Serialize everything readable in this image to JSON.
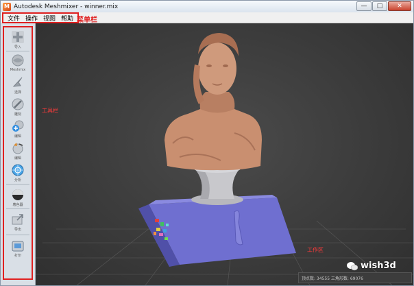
{
  "window": {
    "title": "Autodesk Meshmixer - winner.mix",
    "controls": {
      "minimize": "—",
      "maximize": "□",
      "close": "✕"
    }
  },
  "menubar": {
    "items": [
      "文件",
      "操作",
      "视图",
      "帮助"
    ],
    "annotation": "菜单栏"
  },
  "toolbar": {
    "annotation": "工具栏",
    "tools": [
      {
        "label": "导入",
        "icon": "import-plus-icon"
      },
      {
        "label": "Meshmix",
        "icon": "meshmix-sphere-icon"
      },
      {
        "label": "选择",
        "icon": "select-arrow-icon"
      },
      {
        "label": "雕刻",
        "icon": "sculpt-brush-icon"
      },
      {
        "label": "编辑",
        "icon": "edit-stamp-icon"
      },
      {
        "label": "编辑",
        "icon": "edit-tools-icon"
      },
      {
        "label": "分析",
        "icon": "analysis-icon"
      },
      {
        "label": "着色器",
        "icon": "shaders-icon"
      },
      {
        "label": "导出",
        "icon": "export-icon"
      },
      {
        "label": "打印",
        "icon": "print-icon"
      }
    ]
  },
  "viewport": {
    "annotation": "工作区",
    "status": "顶点数: 34555  三角形数: 69076"
  },
  "watermark": {
    "text": "wish3d"
  },
  "colors": {
    "annotation_red": "#e02020",
    "bust_skin": "#c98f70",
    "base_purple": "#6f6fd0",
    "pedestal_grey": "#c8c8cc",
    "viewport_bg": "#3c3c3c"
  }
}
